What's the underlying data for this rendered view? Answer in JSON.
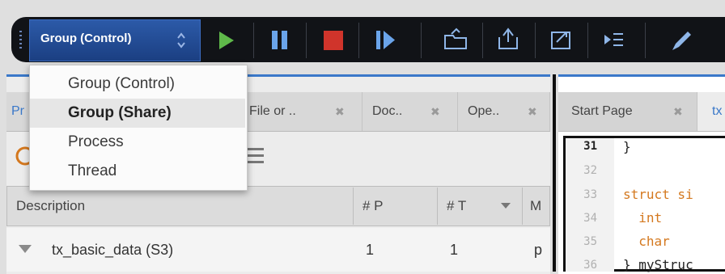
{
  "toolbar": {
    "scope_selector": {
      "value": "Group (Control)"
    },
    "buttons": [
      "play-icon",
      "pause-icon",
      "stop-icon",
      "step-forward-icon",
      "open-folder-icon",
      "save-icon",
      "export-icon",
      "next-line-icon",
      "pencil-icon"
    ]
  },
  "scope_menu": {
    "options": [
      "Group (Control)",
      "Group (Share)",
      "Process",
      "Thread"
    ],
    "selected_index": 1
  },
  "left_tabs": [
    {
      "label": "Pr",
      "close": ""
    },
    {
      "label": "File or ..",
      "close": "✖"
    },
    {
      "label": "Doc..",
      "close": "✖"
    },
    {
      "label": "Ope..",
      "close": "✖"
    }
  ],
  "process_table": {
    "columns": [
      "Description",
      "# P",
      "# T",
      "M"
    ],
    "rows": [
      {
        "description": "tx_basic_data (S3)",
        "p": "1",
        "t": "1",
        "m": "p"
      }
    ]
  },
  "right_tabs": [
    {
      "label": "Start Page",
      "close": "✖"
    },
    {
      "label": "tx",
      "close": ""
    }
  ],
  "editor": {
    "lines": [
      {
        "num": "31",
        "code": "}"
      },
      {
        "num": "32",
        "code": ""
      },
      {
        "num": "33",
        "code": "struct si"
      },
      {
        "num": "34",
        "code": "  int"
      },
      {
        "num": "35",
        "code": "  char"
      },
      {
        "num": "36",
        "code": "} myStruc"
      }
    ]
  },
  "colors": {
    "accent": "#3a78c9",
    "keyword": "#d4781e",
    "play": "#5fb94a",
    "stop": "#d0342b",
    "toolbar_bg": "#111317"
  }
}
